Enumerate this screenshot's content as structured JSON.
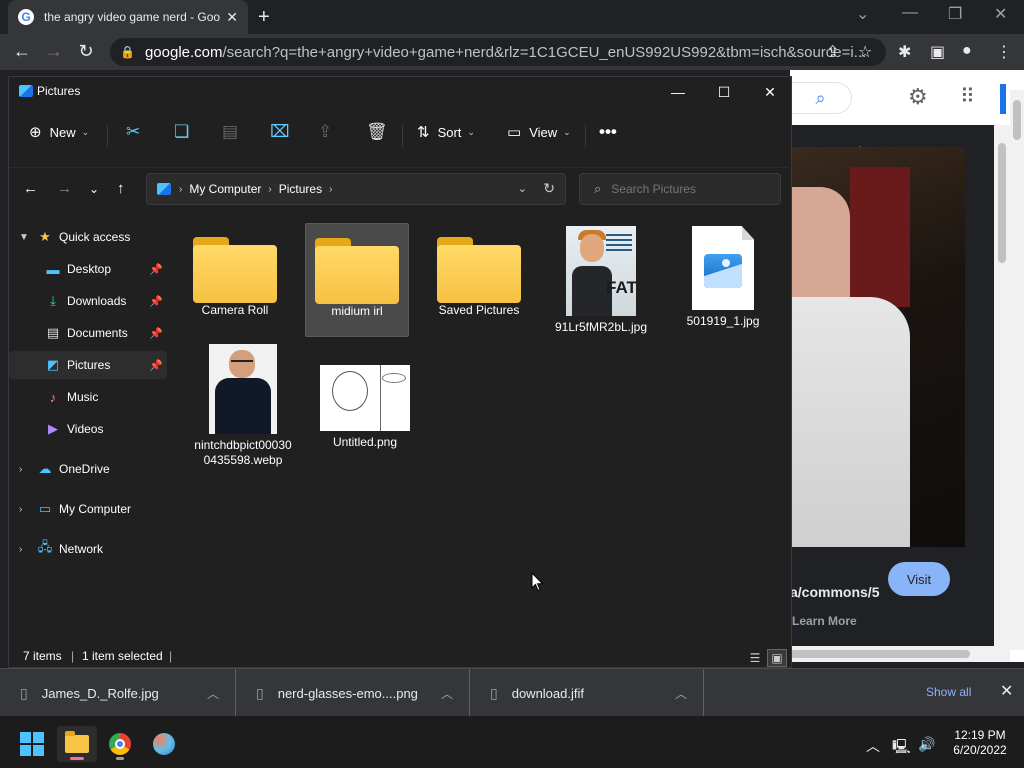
{
  "browser": {
    "tab_title": "the angry video game nerd - Google Search",
    "url_host": "google.com",
    "url_path": "/search?q=the+angry+video+game+nerd&rlz=1C1GCEU_enUS992US992&tbm=isch&source=i..."
  },
  "google_page": {
    "visit_label": "Visit",
    "url_fragment": "a/commons/5",
    "learn_more": "Learn More"
  },
  "explorer": {
    "title": "Pictures",
    "toolbar": {
      "new_label": "New",
      "sort_label": "Sort",
      "view_label": "View"
    },
    "address": {
      "crumbs": [
        "My Computer",
        "Pictures"
      ]
    },
    "search": {
      "placeholder": "Search Pictures"
    },
    "nav": {
      "quick_access": "Quick access",
      "desktop": "Desktop",
      "downloads": "Downloads",
      "documents": "Documents",
      "pictures": "Pictures",
      "music": "Music",
      "videos": "Videos",
      "onedrive": "OneDrive",
      "my_computer": "My Computer",
      "network": "Network"
    },
    "files": [
      {
        "name": "Camera Roll",
        "type": "folder"
      },
      {
        "name": "midium irl",
        "type": "folder"
      },
      {
        "name": "Saved Pictures",
        "type": "folder"
      },
      {
        "name": "91Lr5fMR2bL.jpg",
        "type": "image"
      },
      {
        "name": "501919_1.jpg",
        "type": "image-generic"
      },
      {
        "name": "nintchdbpict000300435598.webp",
        "type": "image"
      },
      {
        "name": "Untitled.png",
        "type": "image"
      }
    ],
    "status": {
      "items": "7 items",
      "selected": "1 item selected"
    }
  },
  "downloads": {
    "items": [
      "James_D._Rolfe.jpg",
      "nerd-glasses-emo....png",
      "download.jfif"
    ],
    "show_all": "Show all"
  },
  "taskbar": {
    "time": "12:19 PM",
    "date": "6/20/2022"
  }
}
